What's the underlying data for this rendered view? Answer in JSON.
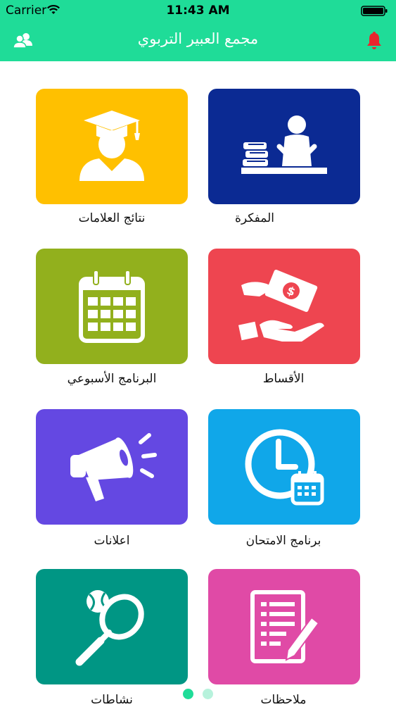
{
  "status_bar": {
    "carrier": "Carrier",
    "time": "11:43 AM",
    "wifi_icon": "wifi-icon",
    "battery_icon": "battery-icon"
  },
  "nav": {
    "title": "مجمع العبير التربوي",
    "left_icon": "users-icon",
    "right_icon": "bell-icon",
    "bell_color": "#e8262d"
  },
  "colors": {
    "header": "#1fdc98",
    "tile_blue": "#0b2a93",
    "tile_yellow": "#ffc000",
    "tile_red": "#ee4550",
    "tile_green": "#92b01d",
    "tile_sky": "#10a7e9",
    "tile_purple": "#6448e2",
    "tile_pink": "#e04aa6",
    "tile_teal": "#009684",
    "dot_active": "#1fdc98",
    "dot_inactive": "#b7f2dc"
  },
  "menu": [
    {
      "label": "المفكرة",
      "icon": "student-desk-icon"
    },
    {
      "label": "نتائج العلامات",
      "icon": "graduate-icon"
    },
    {
      "label": "الأقساط",
      "icon": "money-hand-icon"
    },
    {
      "label": "البرنامج الأسبوعي",
      "icon": "calendar-icon"
    },
    {
      "label": "برنامج الامتحان",
      "icon": "clock-calendar-icon"
    },
    {
      "label": "اعلانات",
      "icon": "megaphone-icon"
    },
    {
      "label": "ملاحظات",
      "icon": "notes-icon"
    },
    {
      "label": "نشاطات",
      "icon": "tennis-icon"
    }
  ],
  "pagination": {
    "pages": 2,
    "current_page": 1
  }
}
